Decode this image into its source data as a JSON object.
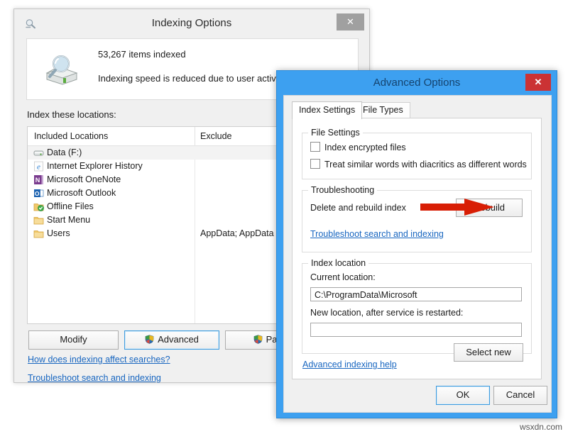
{
  "indexing_options": {
    "title": "Indexing Options",
    "app_icon": "indexing-options-icon",
    "close_label": "✕",
    "status": {
      "icon": "drive-magnifier-icon",
      "items_indexed": "53,267 items indexed",
      "message": "Indexing speed is reduced due to user activity."
    },
    "locations_label": "Index these locations:",
    "list": {
      "columns": [
        "Included Locations",
        "Exclude"
      ],
      "rows": [
        {
          "icon": "drive-icon",
          "name": "Data (F:)",
          "exclude": "",
          "selected": true
        },
        {
          "icon": "ie-icon",
          "name": "Internet Explorer History",
          "exclude": "",
          "selected": false
        },
        {
          "icon": "onenote-icon",
          "name": "Microsoft OneNote",
          "exclude": "",
          "selected": false
        },
        {
          "icon": "outlook-icon",
          "name": "Microsoft Outlook",
          "exclude": "",
          "selected": false
        },
        {
          "icon": "offline-folder-icon",
          "name": "Offline Files",
          "exclude": "",
          "selected": false
        },
        {
          "icon": "folder-icon",
          "name": "Start Menu",
          "exclude": "",
          "selected": false
        },
        {
          "icon": "folder-icon",
          "name": "Users",
          "exclude": "AppData; AppData",
          "selected": false
        }
      ]
    },
    "buttons": {
      "modify": "Modify",
      "advanced": "Advanced",
      "pause": "Pause"
    },
    "links": {
      "how_does": "How does indexing affect searches?",
      "troubleshoot": "Troubleshoot search and indexing"
    }
  },
  "advanced_options": {
    "title": "Advanced Options",
    "close_label": "✕",
    "tabs": [
      {
        "label": "Index Settings",
        "active": true
      },
      {
        "label": "File Types",
        "active": false
      }
    ],
    "file_settings": {
      "group_label": "File Settings",
      "checkboxes": [
        {
          "label": "Index encrypted files",
          "checked": false
        },
        {
          "label": "Treat similar words with diacritics as different words",
          "checked": false
        }
      ]
    },
    "troubleshooting": {
      "group_label": "Troubleshooting",
      "description": "Delete and rebuild index",
      "rebuild_button": "Rebuild",
      "link": "Troubleshoot search and indexing"
    },
    "index_location": {
      "group_label": "Index location",
      "current_label": "Current location:",
      "current_value": "C:\\ProgramData\\Microsoft",
      "new_label": "New location, after service is restarted:",
      "new_value": "",
      "select_new_button": "Select new"
    },
    "advanced_help_link": "Advanced indexing help",
    "buttons": {
      "ok": "OK",
      "cancel": "Cancel"
    },
    "accent_color": "#3da0f0",
    "close_color": "#cb3234"
  },
  "annotation": {
    "arrow": "red-right-arrow",
    "arrow_color": "#d81e05",
    "points_at": "Rebuild"
  },
  "watermark": "wsxdn.com"
}
